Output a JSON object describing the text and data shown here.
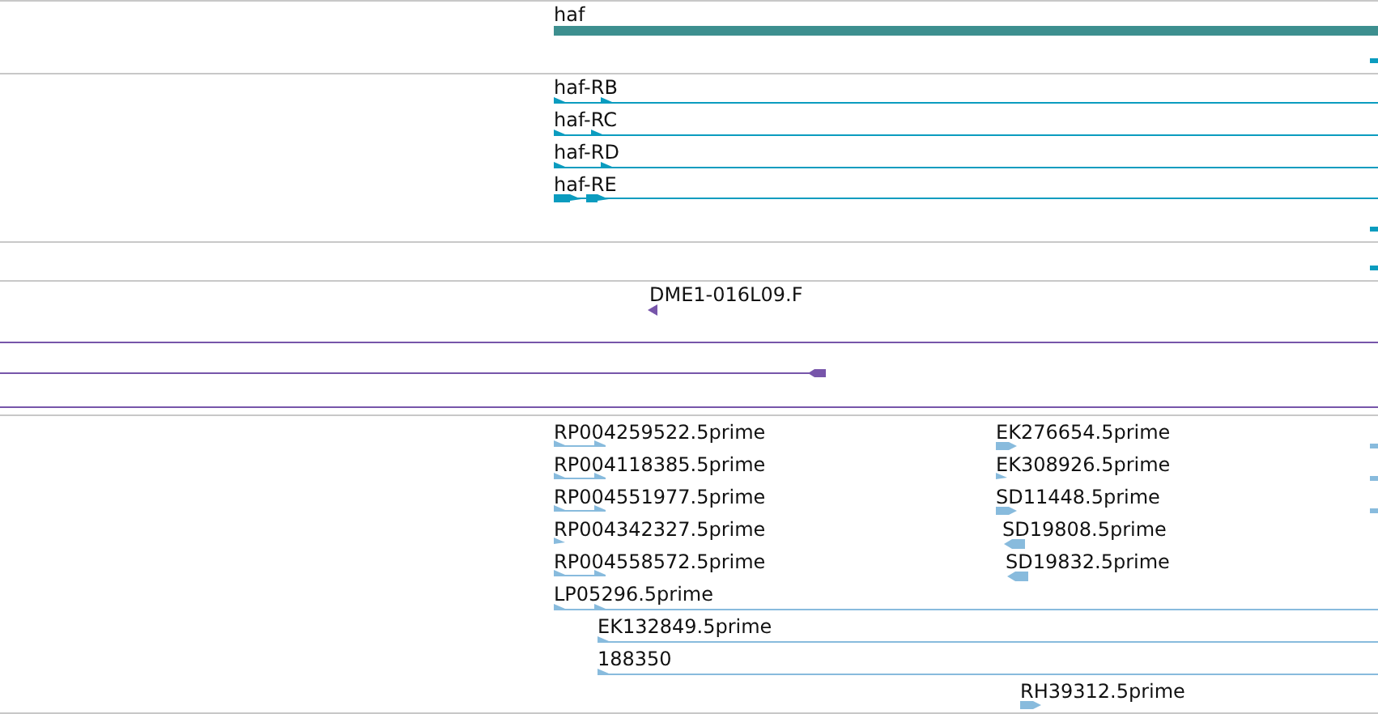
{
  "gene_track": {
    "genes": [
      {
        "label": "haf"
      }
    ]
  },
  "transcript_track": {
    "transcripts": [
      {
        "label": "haf-RB"
      },
      {
        "label": "haf-RC"
      },
      {
        "label": "haf-RD"
      },
      {
        "label": "haf-RE"
      }
    ]
  },
  "clone_track": {
    "clone_ends": [
      {
        "label": "DME1-016L09.F"
      }
    ]
  },
  "est_track": {
    "ests": [
      {
        "label": "RP004259522.5prime"
      },
      {
        "label": "RP004118385.5prime"
      },
      {
        "label": "RP004551977.5prime"
      },
      {
        "label": "RP004342327.5prime"
      },
      {
        "label": "RP004558572.5prime"
      },
      {
        "label": "LP05296.5prime"
      },
      {
        "label": "EK132849.5prime"
      },
      {
        "label": "188350"
      },
      {
        "label": "EK276654.5prime"
      },
      {
        "label": "EK308926.5prime"
      },
      {
        "label": "SD11448.5prime"
      },
      {
        "label": "SD19808.5prime"
      },
      {
        "label": "SD19832.5prime"
      },
      {
        "label": "RH39312.5prime"
      }
    ]
  }
}
